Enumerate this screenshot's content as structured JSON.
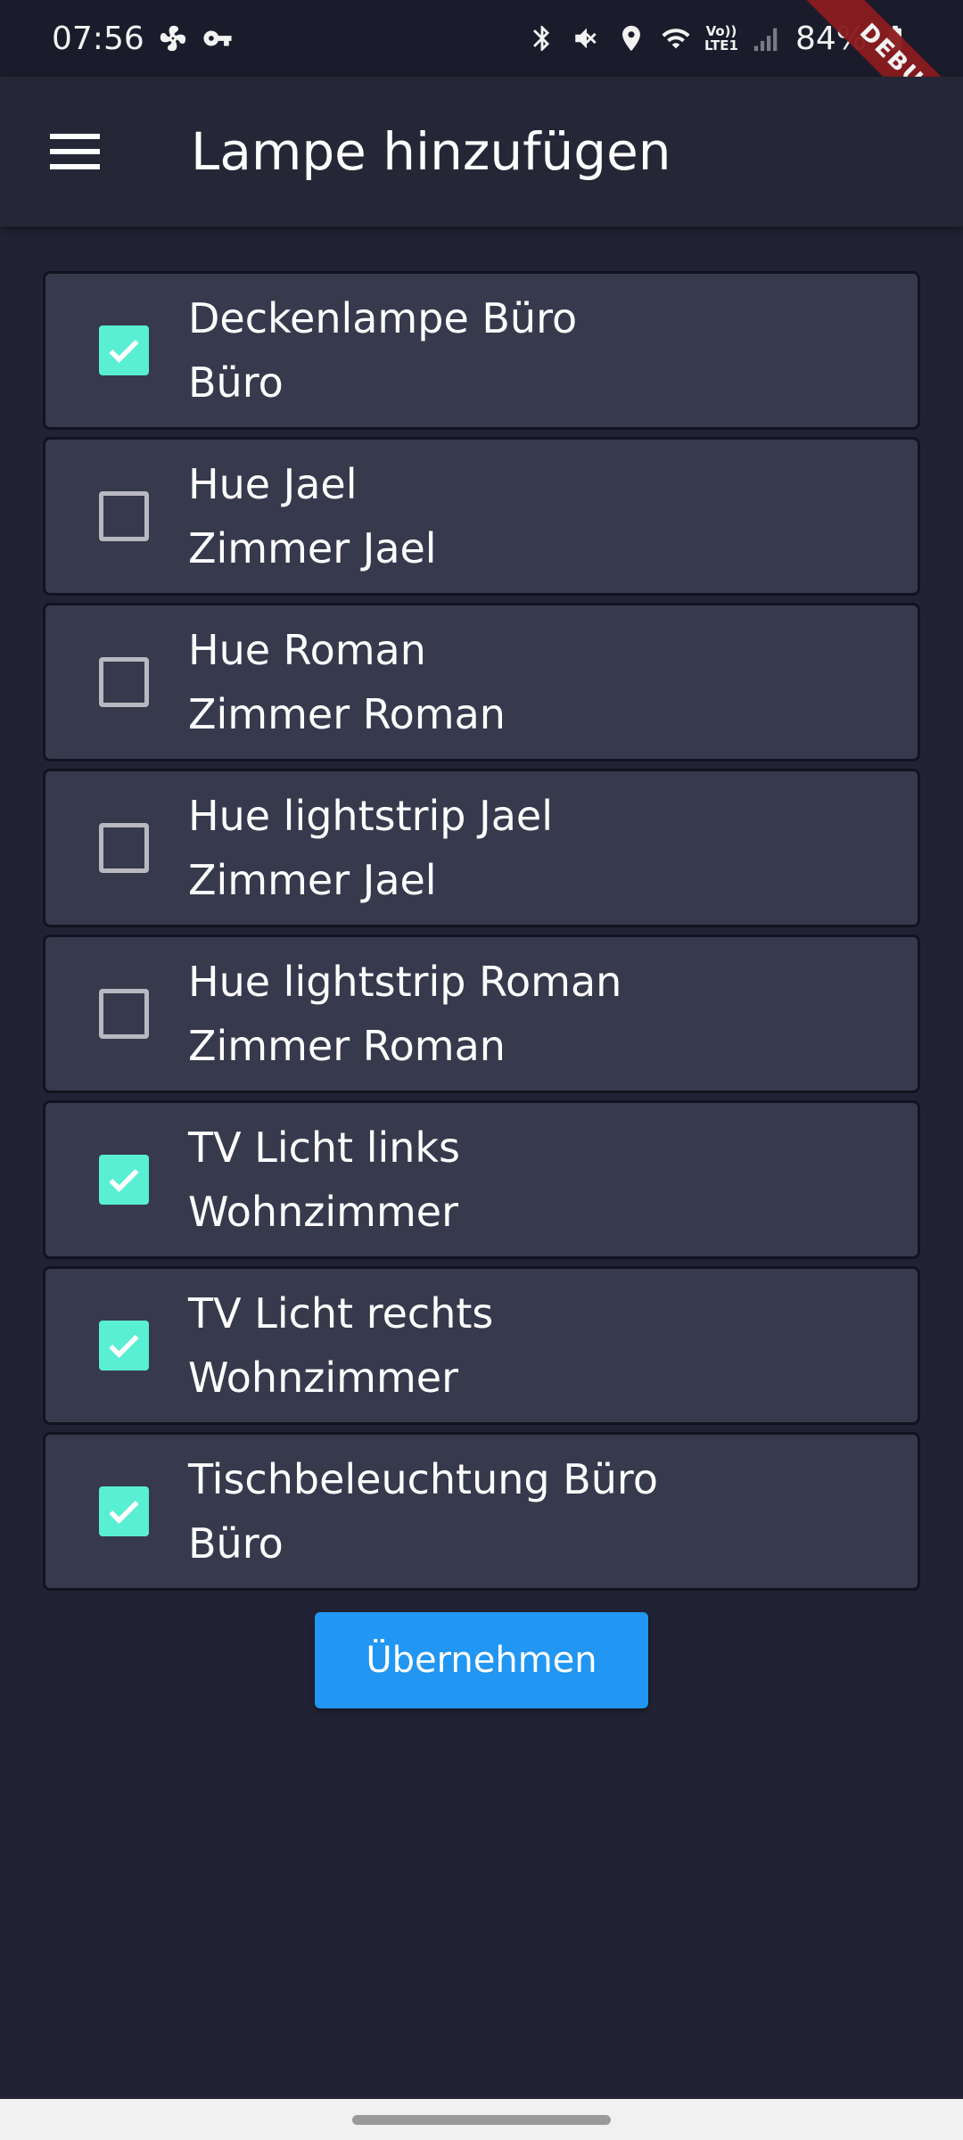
{
  "status_bar": {
    "time": "07:56",
    "battery": "84%",
    "network_top": "Vo))",
    "network_bottom": "LTE1",
    "left_icons": [
      "fan-icon",
      "key-icon"
    ],
    "right_icons": [
      "bluetooth-icon",
      "mute-icon",
      "location-icon",
      "wifi-icon",
      "signal-icon",
      "battery-icon"
    ]
  },
  "debug_banner": "DEBUG",
  "app_bar": {
    "title": "Lampe hinzufügen",
    "menu_icon": "hamburger-menu-icon"
  },
  "lamps": [
    {
      "name": "Deckenlampe Büro",
      "room": "Büro",
      "checked": true
    },
    {
      "name": "Hue Jael",
      "room": "Zimmer Jael",
      "checked": false
    },
    {
      "name": "Hue Roman",
      "room": "Zimmer Roman",
      "checked": false
    },
    {
      "name": "Hue lightstrip Jael",
      "room": "Zimmer Jael",
      "checked": false
    },
    {
      "name": "Hue lightstrip Roman",
      "room": "Zimmer Roman",
      "checked": false
    },
    {
      "name": "TV Licht links",
      "room": "Wohnzimmer",
      "checked": true
    },
    {
      "name": "TV Licht rechts",
      "room": "Wohnzimmer",
      "checked": true
    },
    {
      "name": "Tischbeleuchtung Büro",
      "room": "Büro",
      "checked": true
    }
  ],
  "apply_button": "Übernehmen",
  "colors": {
    "background": "#212334",
    "card": "#373a4d",
    "checkbox_checked": "#58efd3",
    "button": "#2196f3",
    "debug_banner": "#8a1b1f"
  }
}
